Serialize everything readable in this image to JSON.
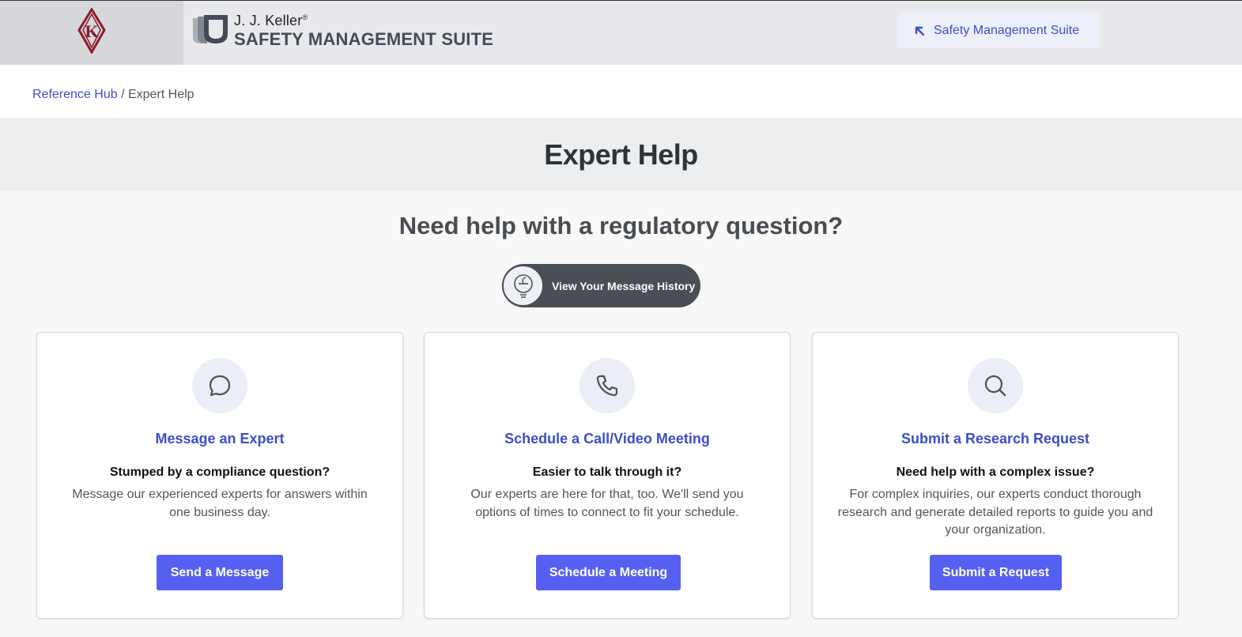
{
  "header": {
    "brand_top": "J. J. Keller",
    "brand_registered": "®",
    "brand_bottom": "SAFETY MANAGEMENT SUITE",
    "suite_button_label": "Safety Management Suite",
    "logo_icon": "jjkeller-k-logo-icon",
    "brand_icon": "shield-stack-icon"
  },
  "breadcrumb": {
    "parent_label": "Reference Hub",
    "separator": " / ",
    "current_label": "Expert Help"
  },
  "page": {
    "title": "Expert Help",
    "subheading": "Need help with a regulatory question?",
    "history_button_label": "View Your Message History"
  },
  "cards": [
    {
      "icon": "chat-bubble-icon",
      "title": "Message an Expert",
      "question": "Stumped by a compliance question?",
      "description": "Message our experienced experts for answers within one business day.",
      "button_label": "Send a Message"
    },
    {
      "icon": "phone-icon",
      "title": "Schedule a Call/Video Meeting",
      "question": "Easier to talk through it?",
      "description": "Our experts are here for that, too. We'll send you options of times to connect to fit your schedule.",
      "button_label": "Schedule a Meeting"
    },
    {
      "icon": "search-icon",
      "title": "Submit a Research Request",
      "question": "Need help with a complex issue?",
      "description": "For complex inquiries, our experts conduct thorough research and generate detailed reports to guide you and your organization.",
      "button_label": "Submit a Request"
    }
  ],
  "colors": {
    "accent": "#3b4fc4",
    "button": "#5560f0",
    "logo_red": "#8b1a2b"
  }
}
